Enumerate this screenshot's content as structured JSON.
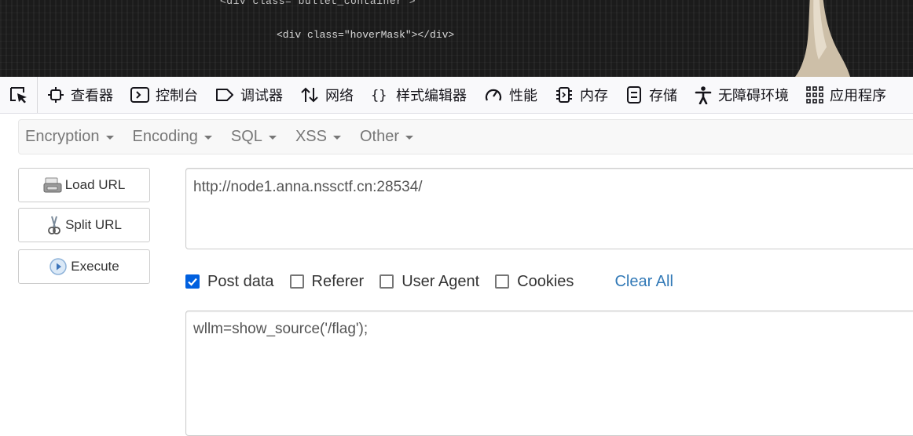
{
  "banner": {
    "code_line_1": "<div class=\"bullet_container\">",
    "code_line_2": "<div class=\"hoverMask\"></div>"
  },
  "devtools": {
    "picker_icon": "element-picker-icon",
    "tabs": [
      {
        "label": "查看器",
        "icon": "inspector-icon"
      },
      {
        "label": "控制台",
        "icon": "console-icon"
      },
      {
        "label": "调试器",
        "icon": "debugger-icon"
      },
      {
        "label": "网络",
        "icon": "network-icon"
      },
      {
        "label": "样式编辑器",
        "icon": "style-editor-icon"
      },
      {
        "label": "性能",
        "icon": "performance-icon"
      },
      {
        "label": "内存",
        "icon": "memory-icon"
      },
      {
        "label": "存储",
        "icon": "storage-icon"
      },
      {
        "label": "无障碍环境",
        "icon": "accessibility-icon"
      },
      {
        "label": "应用程序",
        "icon": "application-icon"
      }
    ]
  },
  "hackbar": {
    "menu": [
      "Encryption",
      "Encoding",
      "SQL",
      "XSS",
      "Other"
    ],
    "load_url": "Load URL",
    "split_url": "Split URL",
    "execute": "Execute",
    "url_value": "http://node1.anna.nssctf.cn:28534/",
    "options": {
      "post_data": "Post data",
      "referer": "Referer",
      "user_agent": "User Agent",
      "cookies": "Cookies",
      "post_data_checked": true,
      "referer_checked": false,
      "user_agent_checked": false,
      "cookies_checked": false
    },
    "clear_all": "Clear All",
    "post_value": "wllm=show_source('/flag');"
  },
  "colors": {
    "accent_blue": "#0060df",
    "link_blue": "#337ab7",
    "menu_text": "#777777"
  }
}
